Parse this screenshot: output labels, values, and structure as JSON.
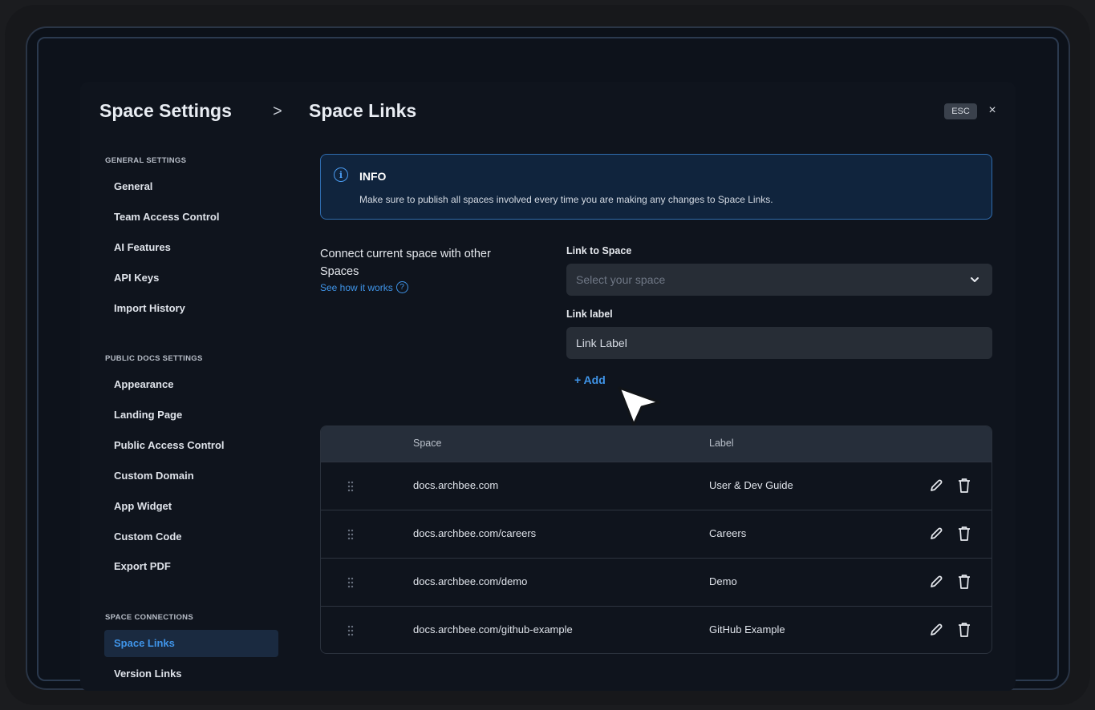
{
  "header": {
    "parent_title": "Space Settings",
    "separator": ">",
    "title": "Space Links",
    "esc_label": "ESC",
    "close_glyph": "×"
  },
  "sidebar": {
    "sections": [
      {
        "heading": "GENERAL SETTINGS",
        "items": [
          "General",
          "Team Access Control",
          "AI Features",
          "API Keys",
          "Import History"
        ]
      },
      {
        "heading": "PUBLIC DOCS SETTINGS",
        "items": [
          "Appearance",
          "Landing Page",
          "Public Access Control",
          "Custom Domain",
          "App Widget",
          "Custom Code",
          "Export PDF"
        ]
      },
      {
        "heading": "SPACE CONNECTIONS",
        "items": [
          "Space Links",
          "Version Links"
        ]
      }
    ],
    "active_item": "Space Links"
  },
  "info": {
    "title": "INFO",
    "text": "Make sure to publish all spaces involved every time you are making any changes to Space Links."
  },
  "connect": {
    "title": "Connect current space with other Spaces",
    "link_text": "See how it works"
  },
  "form": {
    "space_label": "Link to Space",
    "space_placeholder": "Select your space",
    "label_label": "Link label",
    "label_placeholder": "Link Label",
    "add_label": "+ Add"
  },
  "table": {
    "columns": [
      "Space",
      "Label"
    ],
    "rows": [
      {
        "space": "docs.archbee.com",
        "label": "User & Dev Guide"
      },
      {
        "space": "docs.archbee.com/careers",
        "label": "Careers"
      },
      {
        "space": "docs.archbee.com/demo",
        "label": "Demo"
      },
      {
        "space": "docs.archbee.com/github-example",
        "label": "GitHub Example"
      }
    ]
  },
  "colors": {
    "accent": "#3f94e8",
    "background": "#0f141d",
    "info_border": "#2f6cae",
    "info_background": "#10243d"
  },
  "icons": [
    "info-icon",
    "help-icon",
    "chevron-down-icon",
    "drag-handle-icon",
    "edit-icon",
    "trash-icon",
    "cursor-icon",
    "close-icon"
  ]
}
